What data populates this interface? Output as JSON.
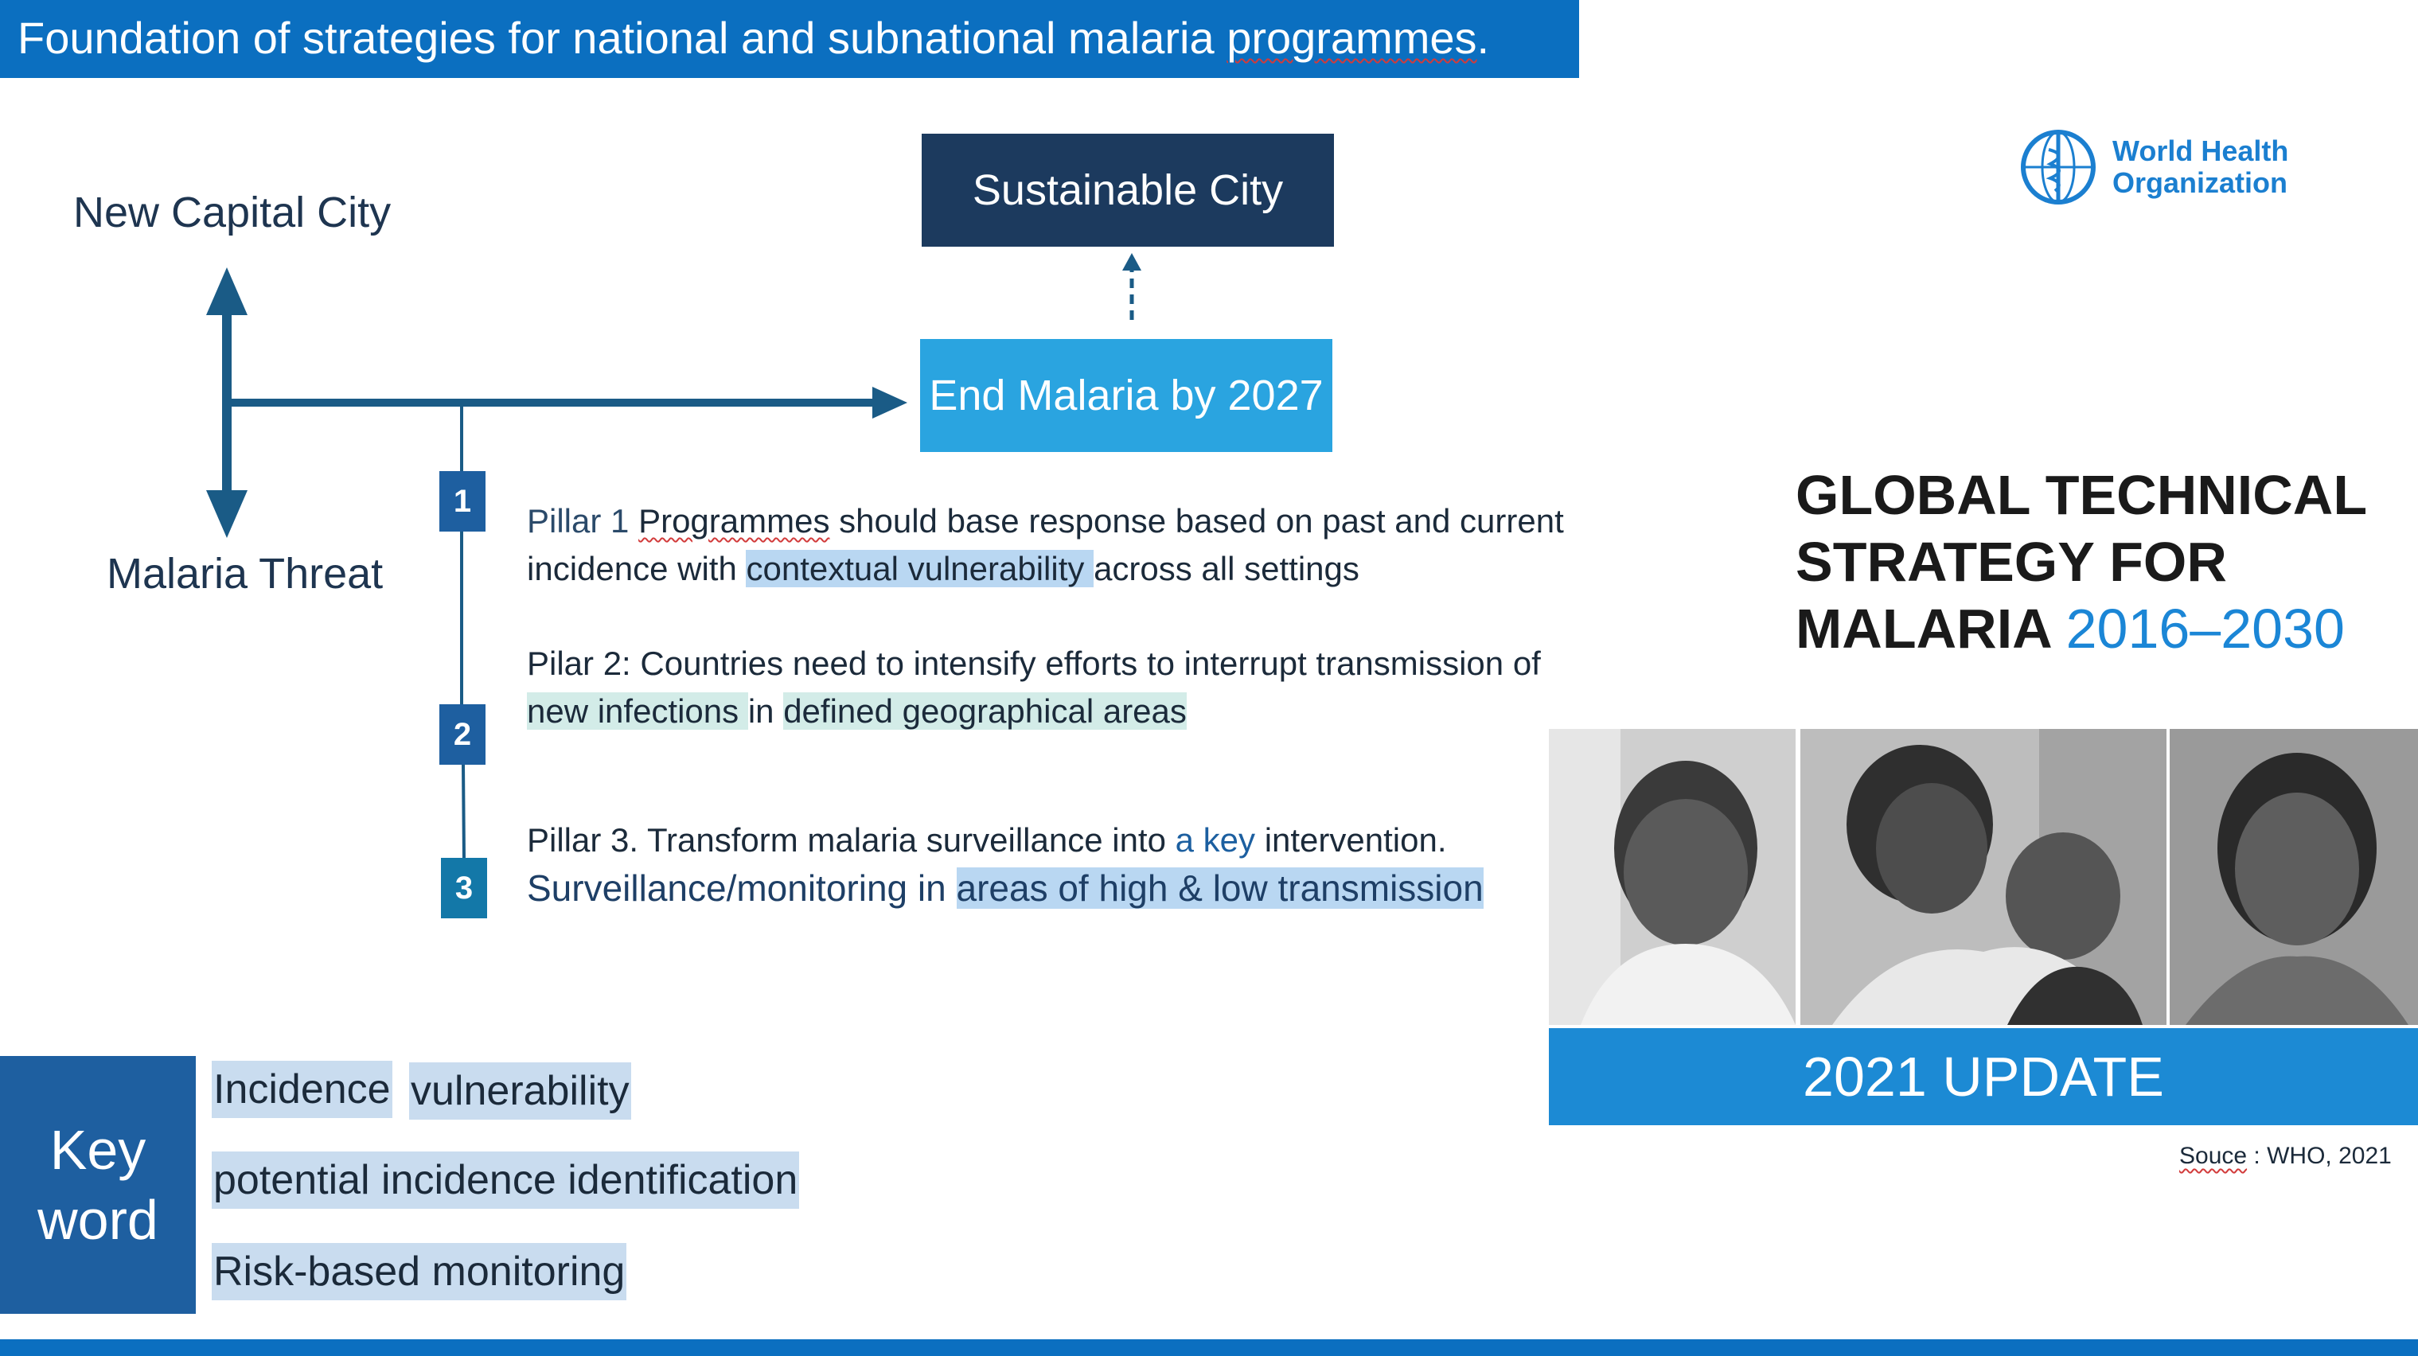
{
  "header": {
    "title_pre": "Foundation of strategies for national and subnational malaria ",
    "title_word": "programmes",
    "title_post": "."
  },
  "flow": {
    "top_label": "New Capital City",
    "bottom_label": "Malaria Threat",
    "sustainable_box": "Sustainable City",
    "end_malaria_box": "End Malaria by 2027"
  },
  "pillars": {
    "p1": {
      "number": "1",
      "label": "Pillar 1 ",
      "word": "Programmes",
      "line1_rest": " should base response based on past and current",
      "line2_pre": "incidence with ",
      "line2_hl": "contextual vulnerability ",
      "line2_post": " across all settings"
    },
    "p2": {
      "number": "2",
      "line1": "Pilar 2: Countries need to intensify efforts to interrupt transmission of",
      "line2_hl1": "new infections ",
      "line2_mid": "in ",
      "line2_hl2": "defined geographical areas"
    },
    "p3": {
      "number": "3",
      "line1_pre": "Pillar 3. Transform malaria surveillance into ",
      "line1_key": "a key",
      "line1_post": " intervention.",
      "line2_pre": "Surveillance/monitoring in ",
      "line2_hl": "areas of high & low transmission"
    }
  },
  "keywords": {
    "title_line1": "Key",
    "title_line2": "word",
    "chips": [
      "Incidence",
      "vulnerability",
      "potential incidence identification",
      "Risk-based monitoring"
    ]
  },
  "right_panel": {
    "who_line1": "World Health",
    "who_line2": "Organization",
    "gts_line1": "GLOBAL TECHNICAL",
    "gts_line2": "STRATEGY FOR",
    "gts_line3": "MALARIA ",
    "gts_years": "2016–2030",
    "update": "2021 UPDATE",
    "source_word": "Souce",
    "source_rest": " : WHO, 2021"
  },
  "colors": {
    "header_blue": "#0b6fc0",
    "navy": "#1c3a5e",
    "sky": "#2aa4e0",
    "arrow": "#1a5b86"
  }
}
